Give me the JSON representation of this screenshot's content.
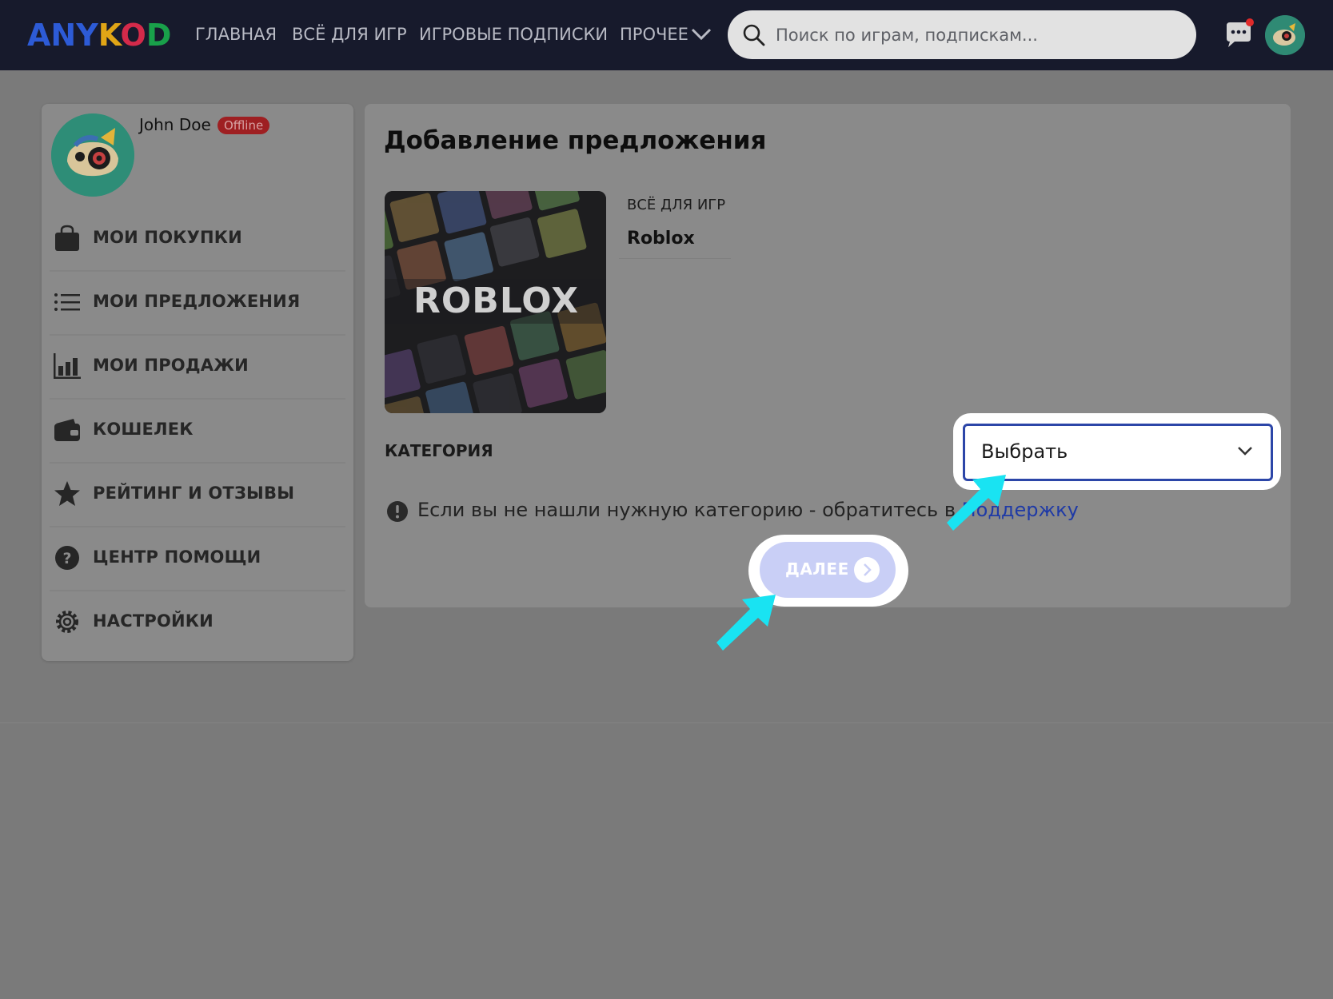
{
  "header": {
    "logo_text": "ANYKOD",
    "nav": [
      "ГЛАВНАЯ",
      "ВСЁ ДЛЯ ИГР",
      "ИГРОВЫЕ ПОДПИСКИ",
      "ПРОЧЕЕ"
    ],
    "search_placeholder": "Поиск по играм, подпискам...",
    "icons": {
      "search": "search-icon",
      "chat": "chat-icon",
      "more": "chevron-down-icon"
    }
  },
  "sidebar": {
    "user_name": "John Doe",
    "status": "Offline",
    "items": [
      {
        "label": "МОИ ПОКУПКИ",
        "icon": "shopping-bag-icon"
      },
      {
        "label": "МОИ ПРЕДЛОЖЕНИЯ",
        "icon": "list-icon"
      },
      {
        "label": "МОИ ПРОДАЖИ",
        "icon": "bar-chart-icon"
      },
      {
        "label": "КОШЕЛЕК",
        "icon": "wallet-icon"
      },
      {
        "label": "РЕЙТИНГ И ОТЗЫВЫ",
        "icon": "star-icon"
      },
      {
        "label": "ЦЕНТР ПОМОЩИ",
        "icon": "help-icon"
      },
      {
        "label": "НАСТРОЙКИ",
        "icon": "gear-icon"
      }
    ]
  },
  "main": {
    "title": "Добавление предложения",
    "game": {
      "category": "ВСЁ ДЛЯ ИГР",
      "name": "Roblox",
      "image_text": "ROBLOX"
    },
    "category_label": "КАТЕГОРИЯ",
    "category_select_value": "Выбрать",
    "info_text": "Если вы не нашли нужную категорию - обратитесь в ",
    "info_link": "Поддержку",
    "next_label": "ДАЛЕЕ"
  },
  "colors": {
    "topbar": "#171a2c",
    "accent_blue": "#2c46a8",
    "arrow": "#19e3f2",
    "badge": "#9e1f22",
    "next_button": "#c9cff6"
  }
}
